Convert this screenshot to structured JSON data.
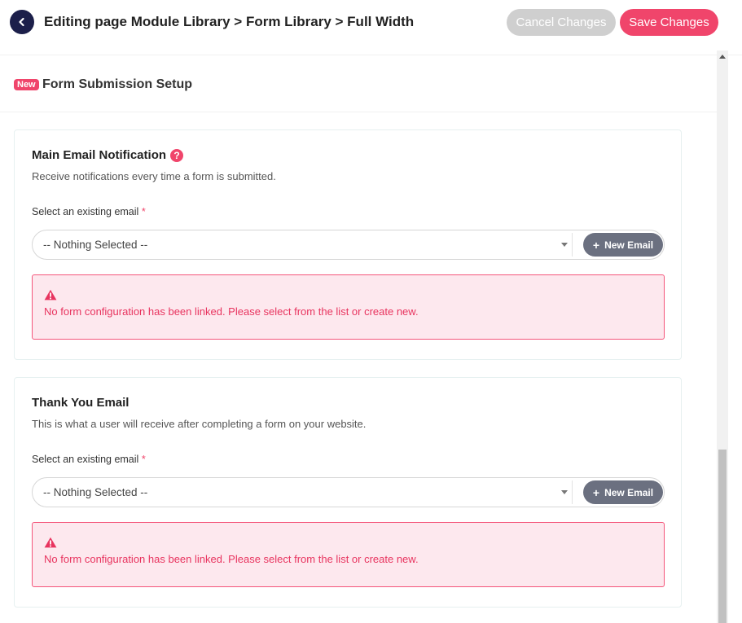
{
  "header": {
    "title": "Editing page Module Library > Form Library > Full Width",
    "cancel_label": "Cancel Changes",
    "save_label": "Save Changes"
  },
  "section": {
    "badge": "New",
    "title": "Form Submission Setup"
  },
  "cards": [
    {
      "title": "Main Email Notification",
      "description": "Receive notifications every time a form is submitted.",
      "field_label": "Select an existing email",
      "required_mark": "*",
      "selected_value": "-- Nothing Selected --",
      "new_email_label": "New Email",
      "alert_text": "No form configuration has been linked. Please select from the list or create new."
    },
    {
      "title": "Thank You Email",
      "description": "This is what a user will receive after completing a form on your website.",
      "field_label": "Select an existing email",
      "required_mark": "*",
      "selected_value": "-- Nothing Selected --",
      "new_email_label": "New Email",
      "alert_text": "No form configuration has been linked. Please select from the list or create new."
    }
  ],
  "colors": {
    "accent": "#f0456b",
    "back_button": "#1c1f4a",
    "cancel_button": "#cfcfcf",
    "new_email_button": "#6b7080",
    "alert_bg": "#fde8ee"
  },
  "icons": {
    "back": "chevron-left-icon",
    "help": "question-circle-icon",
    "warning": "warning-triangle-icon",
    "caret": "caret-down-icon",
    "plus": "plus-icon"
  }
}
